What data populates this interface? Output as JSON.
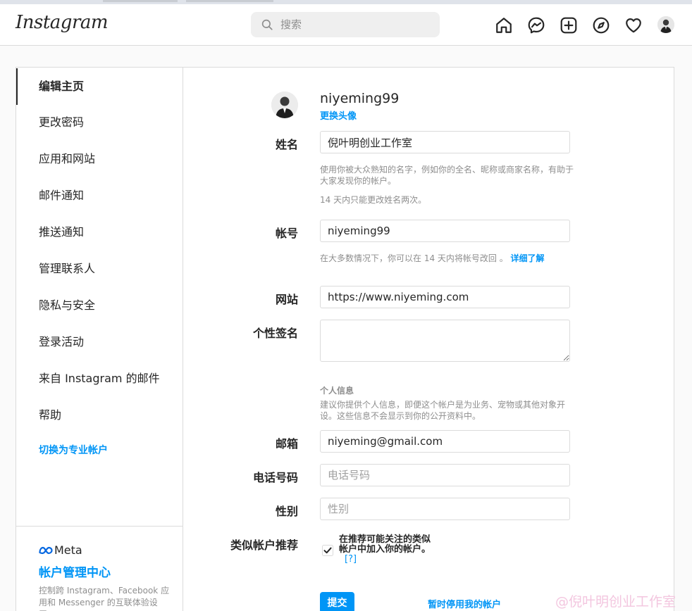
{
  "topbar": {
    "logo": "Instagram",
    "search": {
      "placeholder": "搜索",
      "value": ""
    },
    "icons": [
      "home-icon",
      "messenger-icon",
      "new-post-icon",
      "explore-icon",
      "activity-heart-icon",
      "profile-avatar"
    ]
  },
  "sidebar": {
    "items": [
      {
        "label": "编辑主页",
        "active": true
      },
      {
        "label": "更改密码",
        "active": false
      },
      {
        "label": "应用和网站",
        "active": false
      },
      {
        "label": "邮件通知",
        "active": false
      },
      {
        "label": "推送通知",
        "active": false
      },
      {
        "label": "管理联系人",
        "active": false
      },
      {
        "label": "隐私与安全",
        "active": false
      },
      {
        "label": "登录活动",
        "active": false
      },
      {
        "label": "来自 Instagram 的邮件",
        "active": false
      },
      {
        "label": "帮助",
        "active": false
      }
    ],
    "switch_pro": "切换为专业帐户",
    "meta": {
      "logo_text": "Meta",
      "accounts_center": "帐户管理中心",
      "description": "控制跨 Instagram、Facebook 应用和 Messenger 的互联体验设置，"
    }
  },
  "profile": {
    "username": "niyeming99",
    "change_photo": "更换头像"
  },
  "form": {
    "name": {
      "label": "姓名",
      "value": "倪叶明创业工作室",
      "help1": "使用你被大众熟知的名字，例如你的全名、昵称或商家名称，有助于大家发现你的帐户。",
      "help2": "14 天内只能更改姓名两次。"
    },
    "username": {
      "label": "帐号",
      "value": "niyeming99",
      "help": "在大多数情况下，你可以在 14 天内将帐号改回 。",
      "learn_more": "详细了解"
    },
    "website": {
      "label": "网站",
      "value": "https://www.niyeming.com"
    },
    "bio": {
      "label": "个性签名",
      "value": ""
    },
    "personal_info": {
      "title": "个人信息",
      "help": "建议你提供个人信息，即便这个帐户是为业务、宠物或其他对象开设。这些信息不会显示到你的公开资料中。"
    },
    "email": {
      "label": "邮箱",
      "value": "niyeming@gmail.com"
    },
    "phone": {
      "label": "电话号码",
      "placeholder": "电话号码",
      "value": ""
    },
    "gender": {
      "label": "性别",
      "placeholder": "性别",
      "value": ""
    },
    "suggestions": {
      "label": "类似帐户推荐",
      "checked": true,
      "text": "在推荐可能关注的类似帐户中加入你的帐户。",
      "help_link": "[?]"
    },
    "submit": "提交",
    "disable": "暂时停用我的帐户"
  },
  "watermark": "@倪叶明创业工作室",
  "colors": {
    "accent": "#0095f6",
    "border": "#dbdbdb",
    "muted": "#8e8e8e"
  }
}
